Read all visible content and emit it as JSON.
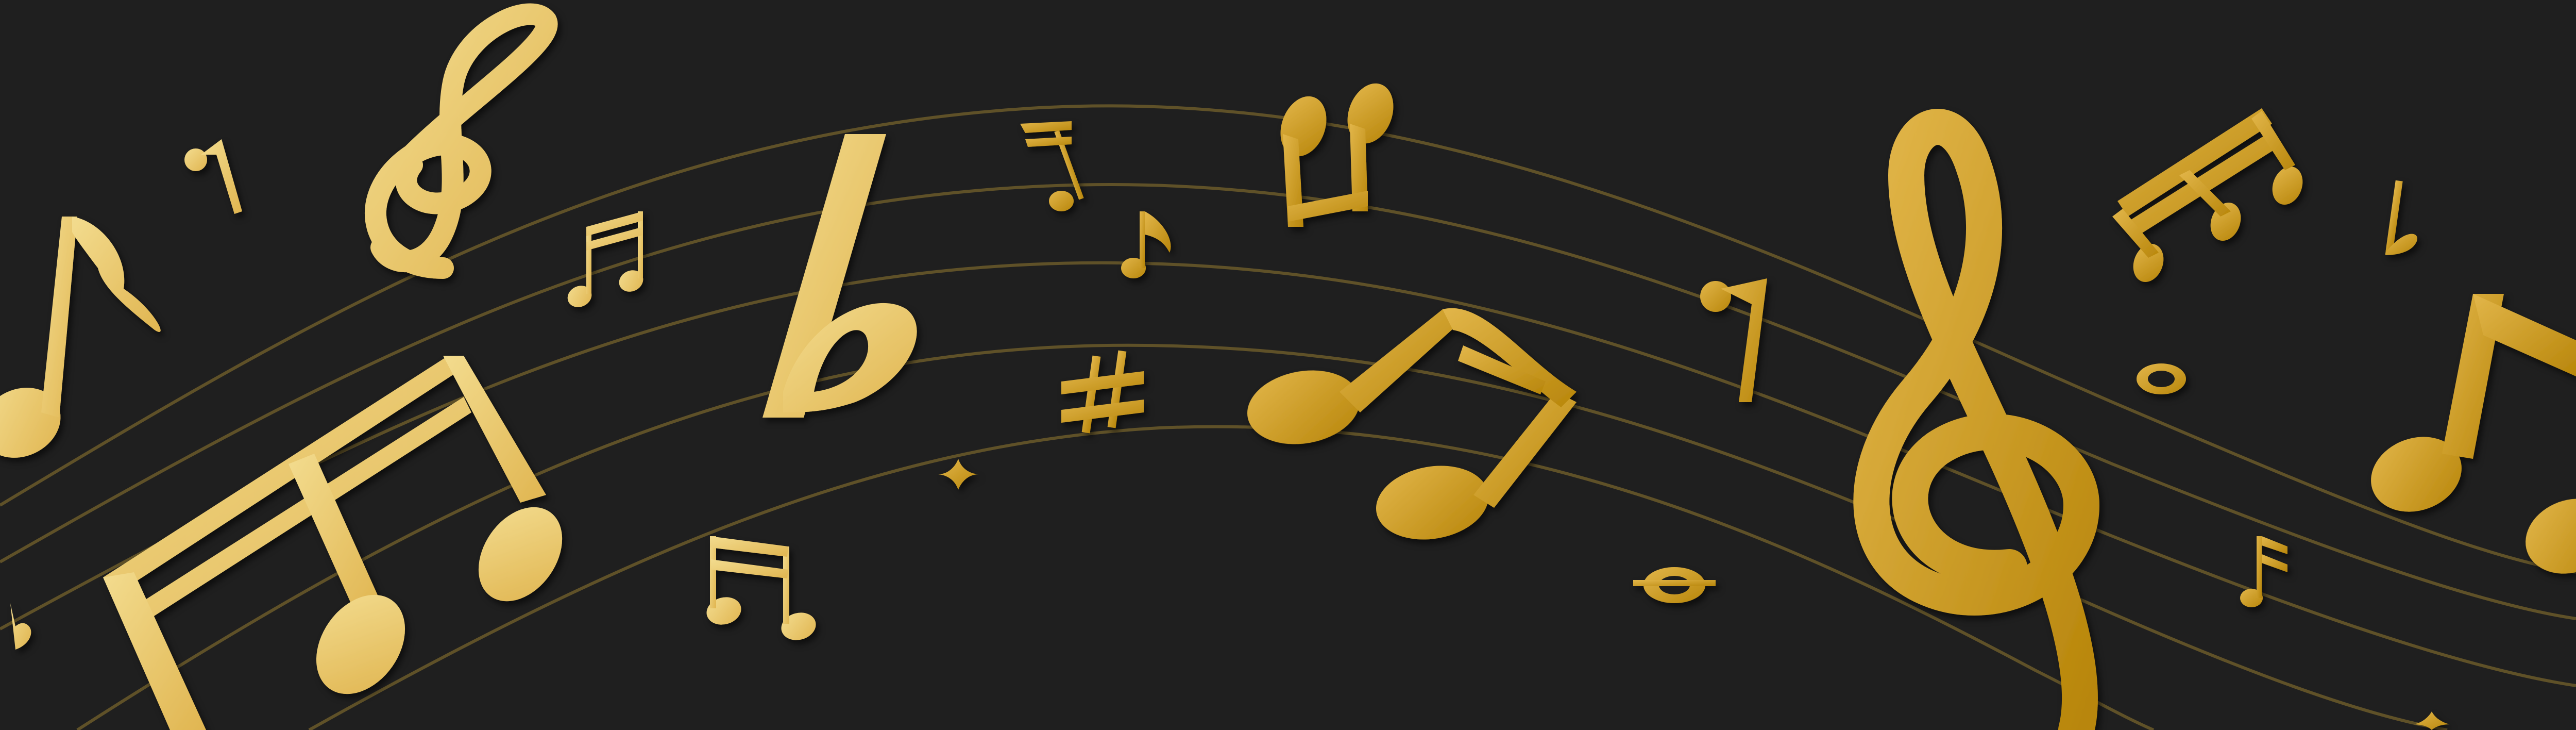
{
  "scene": {
    "background_color": "#1f1f1f",
    "staff_color": "#6b5a2a",
    "gold_light": "#f1d98a",
    "gold_mid": "#d9aa3a",
    "gold_dark": "#b8860b",
    "elements": [
      {
        "kind": "treble-clef-icon"
      },
      {
        "kind": "treble-clef-icon"
      },
      {
        "kind": "flat-icon"
      },
      {
        "kind": "flat-icon"
      },
      {
        "kind": "flat-icon"
      },
      {
        "kind": "sharp-icon"
      },
      {
        "kind": "eighth-note-icon"
      },
      {
        "kind": "beamed-eighth-notes-icon"
      },
      {
        "kind": "beamed-sixteenth-notes-icon"
      },
      {
        "kind": "whole-note-icon"
      },
      {
        "kind": "natural-icon"
      },
      {
        "kind": "rest-icon"
      },
      {
        "kind": "ornament-icon"
      }
    ]
  }
}
